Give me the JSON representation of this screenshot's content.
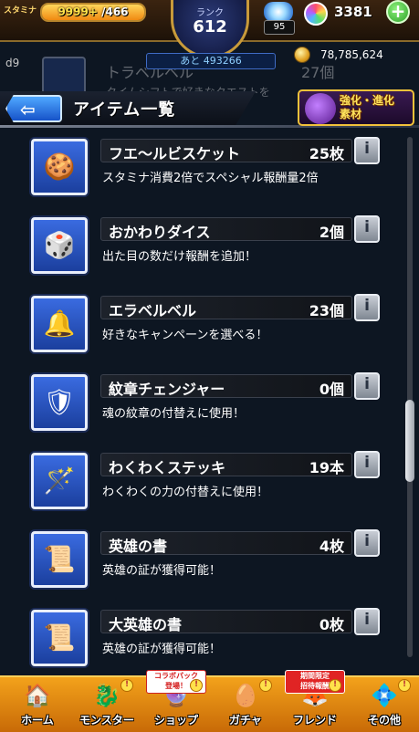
{
  "status": {
    "stamina_label": "スタミナ",
    "stamina_current": "9999+",
    "stamina_max": "/466",
    "stamina_fill": 1.0,
    "rank_label": "ランク",
    "rank_value": "612",
    "exp_to_next": "あと 493266",
    "orb_count": "95",
    "gem_count": "3381",
    "coin_count": "78,785,624"
  },
  "ghost": {
    "left_tag": "d9",
    "name": "トラベルベル",
    "count": "27個",
    "desc": "タイムシフトで好きなクエストを"
  },
  "header": {
    "back_arrow": "⇦",
    "title": "アイテム一覧",
    "evolve_label_1": "強化・進化",
    "evolve_label_2": "素材"
  },
  "items": [
    {
      "name": "フエ〜ルビスケット",
      "count": "25枚",
      "desc": "スタミナ消費2倍でスペシャル報酬量2倍",
      "icon": "biscuit-icon",
      "glyph": "🍪"
    },
    {
      "name": "おかわりダイス",
      "count": "2個",
      "desc": "出た目の数だけ報酬を追加！",
      "icon": "dice-icon",
      "glyph": "🎲"
    },
    {
      "name": "エラベルベル",
      "count": "23個",
      "desc": "好きなキャンペーンを選べる！",
      "icon": "bell-icon",
      "glyph": "🔔"
    },
    {
      "name": "紋章チェンジャー",
      "count": "0個",
      "desc": "魂の紋章の付替えに使用！",
      "icon": "emblem-changer-icon",
      "glyph": "🛡"
    },
    {
      "name": "わくわくステッキ",
      "count": "19本",
      "desc": "わくわくの力の付替えに使用！",
      "icon": "wand-icon",
      "glyph": "🪄"
    },
    {
      "name": "英雄の書",
      "count": "4枚",
      "desc": "英雄の証が獲得可能！",
      "icon": "scroll-icon",
      "glyph": "📜"
    },
    {
      "name": "大英雄の書",
      "count": "0枚",
      "desc": "英雄の証が獲得可能！",
      "icon": "grand-scroll-icon",
      "glyph": "📜"
    }
  ],
  "info_glyph": "i",
  "scroll_position": 0.6,
  "nav": [
    {
      "label": "ホーム",
      "icon": "home-icon",
      "glyph": "🏠",
      "badge": "",
      "alert": false
    },
    {
      "label": "モンスター",
      "icon": "monster-icon",
      "glyph": "🐉",
      "badge": "",
      "alert": true
    },
    {
      "label": "ショップ",
      "icon": "shop-icon",
      "glyph": "🔮",
      "badge": "コラボパック\n登場！",
      "alert": true
    },
    {
      "label": "ガチャ",
      "icon": "gacha-icon",
      "glyph": "🥚",
      "badge": "",
      "alert": true
    },
    {
      "label": "フレンド",
      "icon": "friend-icon",
      "glyph": "🦊",
      "badge": "期間限定\n招待報酬",
      "alert": true
    },
    {
      "label": "その他",
      "icon": "more-icon",
      "glyph": "💠",
      "badge": "",
      "alert": true
    }
  ],
  "colors": {
    "background": "#0d1622",
    "nav_orange": "#f3a21b",
    "item_blue": "#3a6be0",
    "accent_gold": "#f2c23a"
  }
}
